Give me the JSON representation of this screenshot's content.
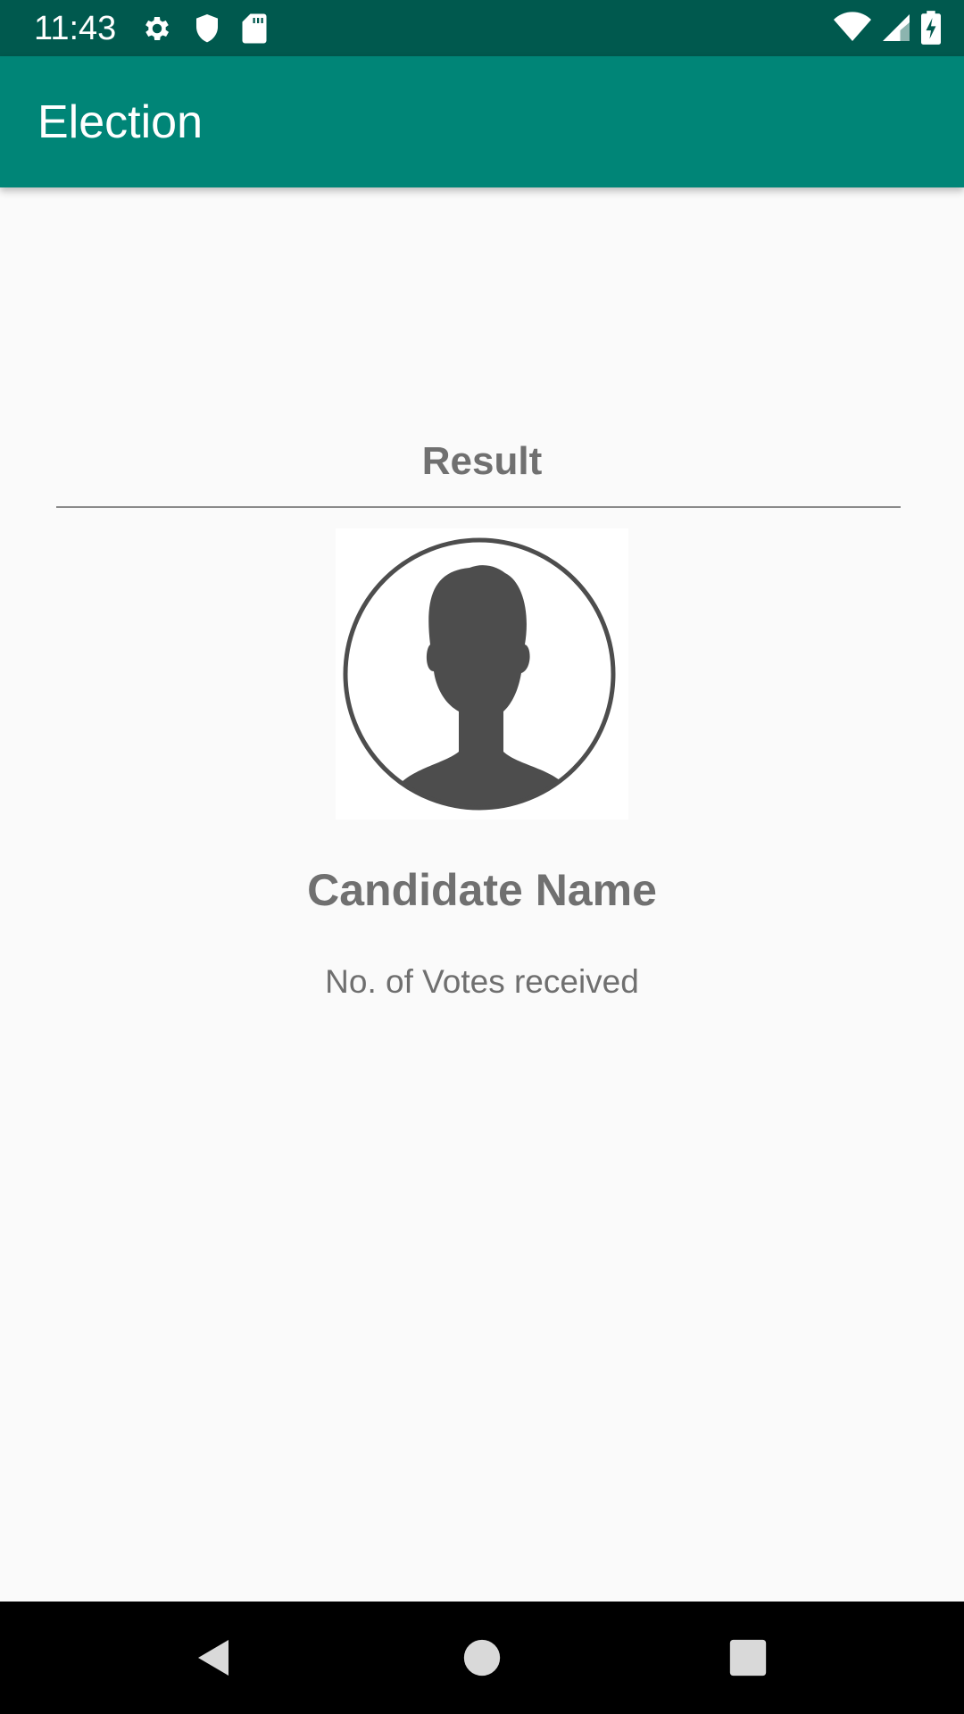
{
  "status_bar": {
    "time": "11:43",
    "left_icons": [
      "gear-icon",
      "shield-icon",
      "sd-card-icon"
    ],
    "right_icons": [
      "wifi-icon",
      "cell-signal-icon",
      "battery-charging-icon"
    ],
    "color": "#00594e"
  },
  "app_bar": {
    "title": "Election",
    "color": "#008577"
  },
  "main": {
    "heading": "Result",
    "avatar_icon": "person-avatar-icon",
    "candidate_name": "Candidate Name",
    "votes_text": "No. of Votes received"
  },
  "nav_bar": {
    "buttons": [
      "back-icon",
      "home-icon",
      "recents-icon"
    ]
  }
}
